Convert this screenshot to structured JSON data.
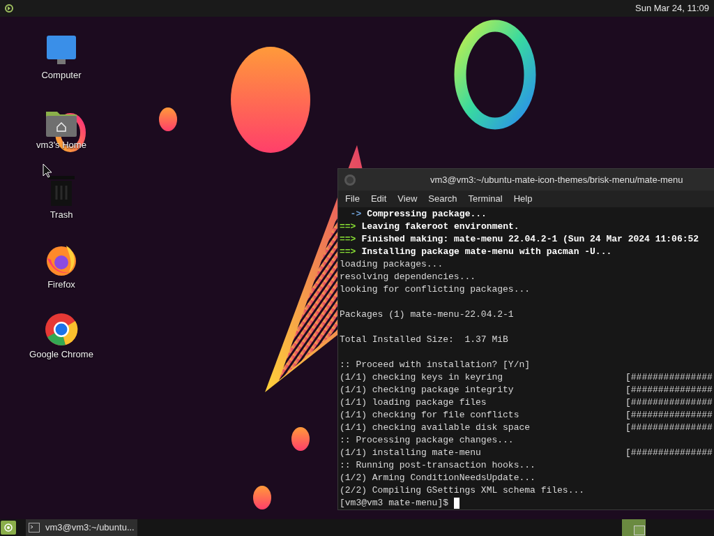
{
  "top_panel": {
    "clock": "Sun Mar 24, 11:09"
  },
  "desktop_icons": [
    {
      "kind": "computer",
      "label": "Computer"
    },
    {
      "kind": "home",
      "label": "vm3's Home"
    },
    {
      "kind": "trash",
      "label": "Trash"
    },
    {
      "kind": "firefox",
      "label": "Firefox"
    },
    {
      "kind": "chrome",
      "label": "Google Chrome"
    }
  ],
  "terminal": {
    "title": "vm3@vm3:~/ubuntu-mate-icon-themes/brisk-menu/mate-menu",
    "menu": [
      "File",
      "Edit",
      "View",
      "Search",
      "Terminal",
      "Help"
    ],
    "lines": [
      {
        "kind": "arrow",
        "prefix": "  ->",
        "text": "Compressing package..."
      },
      {
        "kind": "marker",
        "prefix": "==>",
        "text": "Leaving fakeroot environment."
      },
      {
        "kind": "marker",
        "prefix": "==>",
        "text": "Finished making: mate-menu 22.04.2-1 (Sun 24 Mar 2024 11:06:52"
      },
      {
        "kind": "marker",
        "prefix": "==>",
        "text": "Installing package mate-menu with pacman -U..."
      },
      {
        "kind": "plain",
        "text": "loading packages..."
      },
      {
        "kind": "plain",
        "text": "resolving dependencies..."
      },
      {
        "kind": "plain",
        "text": "looking for conflicting packages..."
      },
      {
        "kind": "blank"
      },
      {
        "kind": "plain",
        "text": "Packages (1) mate-menu-22.04.2-1"
      },
      {
        "kind": "blank"
      },
      {
        "kind": "plain",
        "text": "Total Installed Size:  1.37 MiB"
      },
      {
        "kind": "blank"
      },
      {
        "kind": "plain",
        "text": ":: Proceed with installation? [Y/n]"
      },
      {
        "kind": "progress",
        "text": "(1/1) checking keys in keyring",
        "bar": "[###############"
      },
      {
        "kind": "progress",
        "text": "(1/1) checking package integrity",
        "bar": "[###############"
      },
      {
        "kind": "progress",
        "text": "(1/1) loading package files",
        "bar": "[###############"
      },
      {
        "kind": "progress",
        "text": "(1/1) checking for file conflicts",
        "bar": "[###############"
      },
      {
        "kind": "progress",
        "text": "(1/1) checking available disk space",
        "bar": "[###############"
      },
      {
        "kind": "plain",
        "text": ":: Processing package changes..."
      },
      {
        "kind": "progress",
        "text": "(1/1) installing mate-menu",
        "bar": "[###############"
      },
      {
        "kind": "plain",
        "text": ":: Running post-transaction hooks..."
      },
      {
        "kind": "plain",
        "text": "(1/2) Arming ConditionNeedsUpdate..."
      },
      {
        "kind": "plain",
        "text": "(2/2) Compiling GSettings XML schema files..."
      },
      {
        "kind": "prompt",
        "text": "[vm3@vm3 mate-menu]$"
      }
    ]
  },
  "bottom_panel": {
    "tasks": [
      {
        "label": "vm3@vm3:~/ubuntu...",
        "selected": true
      }
    ],
    "workspaces": [
      {
        "selected": true
      }
    ]
  }
}
